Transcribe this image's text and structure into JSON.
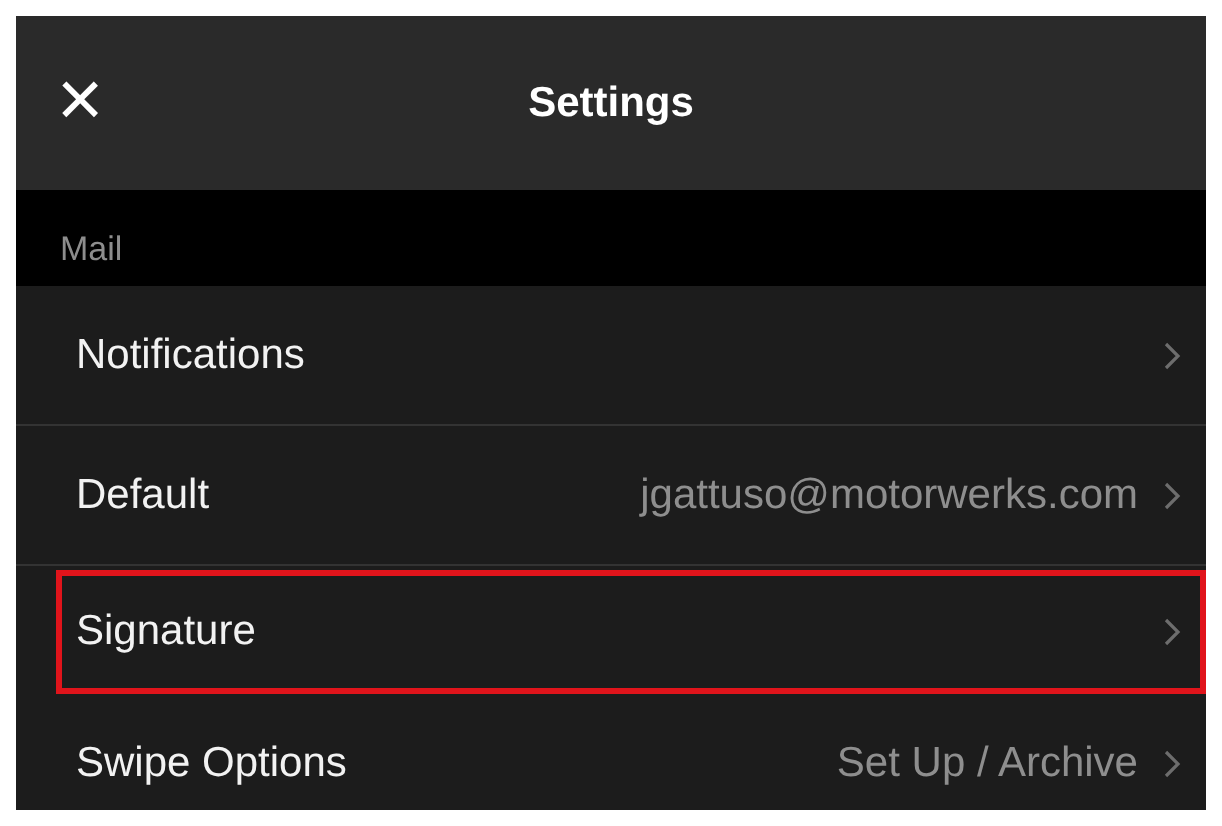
{
  "header": {
    "close": "×",
    "title": "Settings"
  },
  "section": {
    "label": "Mail"
  },
  "rows": [
    {
      "label": "Notifications",
      "value": null,
      "highlighted": false
    },
    {
      "label": "Default",
      "value": "jgattuso@motorwerks.com",
      "highlighted": false
    },
    {
      "label": "Signature",
      "value": null,
      "highlighted": true
    },
    {
      "label": "Swipe Options",
      "value": "Set Up / Archive",
      "highlighted": false
    }
  ]
}
